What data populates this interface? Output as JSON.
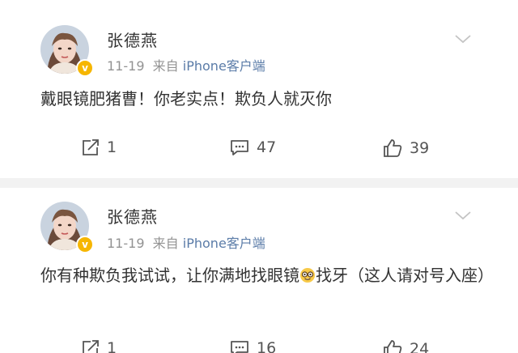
{
  "posts": [
    {
      "username": "张德燕",
      "date": "11-19",
      "source_prefix": "来自",
      "source": "iPhone客户端",
      "text": "戴眼镜肥猪曹！你老实点！欺负人就灭你",
      "reposts": "1",
      "comments": "47",
      "likes": "39"
    },
    {
      "username": "张德燕",
      "date": "11-19",
      "source_prefix": "来自",
      "source": "iPhone客户端",
      "text_before_emoji": "你有种欺负我试试，让你满地找眼镜",
      "emoji": "nerd-face-emoji",
      "text_after_emoji": "找牙（这人请对号入座）",
      "reposts": "1",
      "comments": "16",
      "likes": "24"
    }
  ],
  "colors": {
    "text": "#333333",
    "meta": "#939393",
    "source_link": "#5b7ca8",
    "verified_badge": "#f6b600",
    "background": "#f2f2f2"
  },
  "icons": [
    "repost-icon",
    "comment-icon",
    "like-icon",
    "chevron-down-icon",
    "verified-badge-icon"
  ]
}
